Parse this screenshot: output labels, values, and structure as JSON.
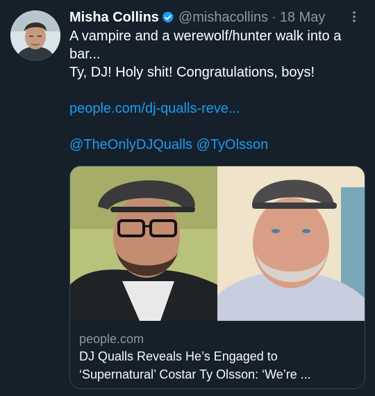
{
  "tweet": {
    "author_name": "Misha Collins",
    "handle": "@mishacollins",
    "separator": "·",
    "date": "18 May",
    "text_line1": "A vampire and a werewolf/hunter walk into a bar...",
    "text_line2": "Ty, DJ! Holy shit! Congratulations, boys!",
    "link": "people.com/dj-qualls-reve...",
    "mention1": "@TheOnlyDJQualls",
    "mention2": "@TyOlsson"
  },
  "card": {
    "domain": "people.com",
    "title": "DJ Qualls Reveals He’s Engaged to ‘Supernatural’ Costar Ty Olsson: ‘We’re ..."
  },
  "colors": {
    "background": "#15202b",
    "link": "#1d9bf0",
    "secondary_text": "#8b98a5",
    "verified": "#1d9bf0"
  },
  "icons": {
    "verified": "verified-badge-icon",
    "more": "more-options-icon"
  }
}
